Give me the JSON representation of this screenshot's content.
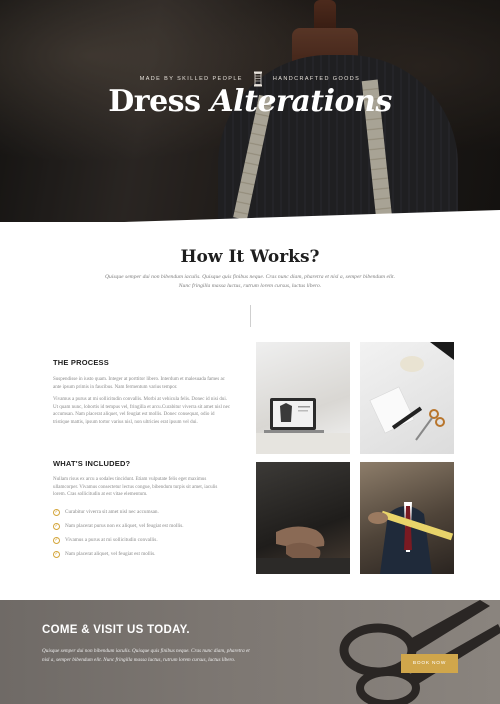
{
  "hero": {
    "kicker_left": "MADE BY SKILLED PEOPLE",
    "kicker_right": "HANDCRAFTED GOODS",
    "title_main": "Dress",
    "title_italic": "Alterations",
    "separator_icon": "spool-of-thread-icon"
  },
  "how": {
    "title": "How It Works?",
    "subtitle": "Quisque semper dui non bibendum iaculis. Quisque quis finibus neque. Cras nunc diam, pharetra et nisl a, semper bibendum elit. Nunc fringilla massa luctus, rutrum lorem cursus, luctus libero."
  },
  "process": {
    "heading": "THE PROCESS",
    "p1": "Suspendisse in iusto quam. Integer at porttitor libero. Interdum et malesuada fames ac ante ipsum primis in faucibus. Nam fermentum varius tempor.",
    "p2": "Vivamus a purus at mi sollicitudin convallis. Morbi at vehicula felis. Donec id nisi dui. Ut quam nunc, lobortis id tempus vel, fringilla et arcu.Curabitur viverra sit amet nisl nec accumsan. Nam placerat aliquet, vel feugiat est mollis. Donec consequat, odio id tristique mattis, ipsum tortor varius nisl, non ultricies erat ipsum vel dui."
  },
  "included": {
    "heading": "WHAT'S INCLUDED?",
    "p": "Nullam risus ex arcu a sodales tincidunt. Etiam vulputate felis eget maximus ullamcorper. Vivamus consectetur lectus congue, bibendum turpis sit amet, iaculis lorem. Cras sollicitudin at est vitae elementum.",
    "items": [
      "Curabitur viverra sit amet nisl nec accumsan.",
      "Nam placerat purus non ex aliquet, vel feugiat est mollis.",
      "Vivamus a purus at mi sollicitudin convallis.",
      "Nam placerat aliquet, vel feugiat est mollis."
    ],
    "check_icon": "check-circle-icon"
  },
  "photos": [
    {
      "name": "laptop-desk-photo"
    },
    {
      "name": "sketchbook-scissors-photo"
    },
    {
      "name": "tailor-hands-photo"
    },
    {
      "name": "measuring-tape-suit-photo"
    }
  ],
  "cta": {
    "title": "COME & VISIT US TODAY.",
    "text": "Quisque semper dui non bibendum iaculis. Quisque quis finibus neque. Cras nunc diam, pharetra et nisl a, semper bibendum elit. Nunc fringilla massa luctus, rutrum lorem cursus, luctus libero.",
    "button": "BOOK NOW",
    "accent_color": "#d0a64b"
  }
}
